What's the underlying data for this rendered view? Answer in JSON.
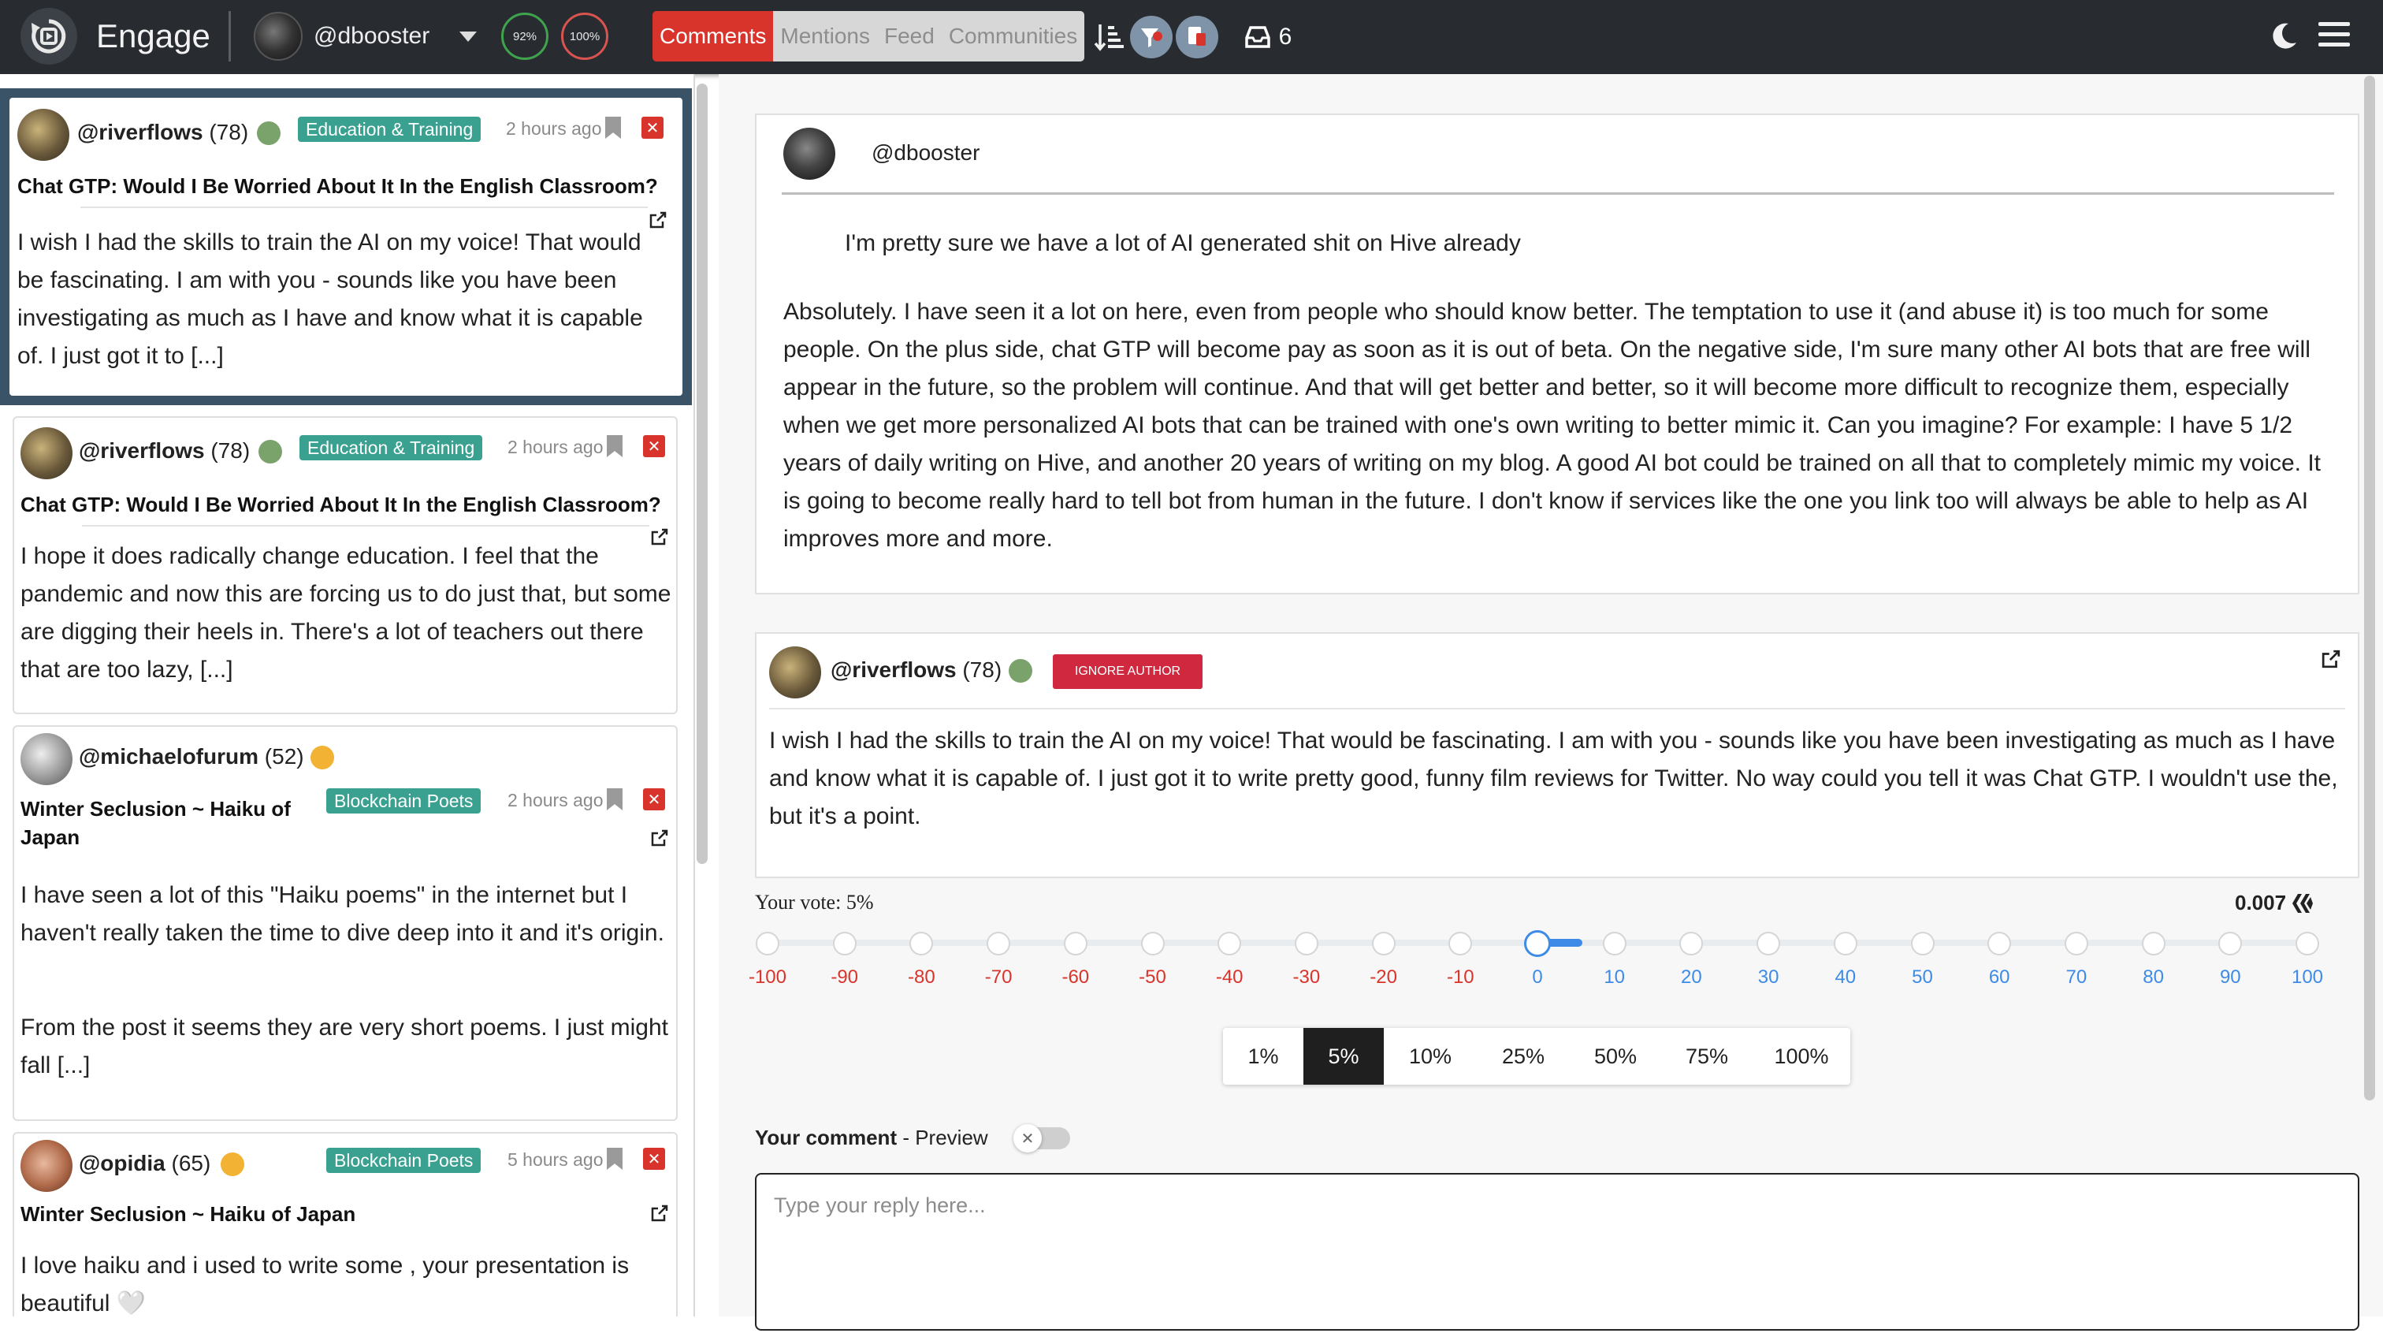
{
  "app": {
    "title": "Engage",
    "account": "@dbooster",
    "gauge_vp": "92%",
    "gauge_rc": "100%",
    "tabs": [
      {
        "label": "Comments",
        "active": true
      },
      {
        "label": "Mentions",
        "active": false
      },
      {
        "label": "Feed",
        "active": false
      },
      {
        "label": "Communities",
        "active": false
      }
    ],
    "inbox_count": "6",
    "colors": {
      "accent": "#d9342b",
      "topbar": "#282c31",
      "tag": "#3aa090",
      "vote_blue": "#3d8be6"
    }
  },
  "sidebar": {
    "cards": [
      {
        "author": "@riverflows",
        "rep": "(78)",
        "tag": "Education & Training",
        "time": "2 hours ago",
        "title": "Chat GTP: Would I Be Worried About It In the English Classroom?",
        "body": "I wish I had the skills to train the AI on my voice! That would be fascinating. I am with you - sounds like you have been investigating as much as I have and know what it is capable of. I just got it to [...]"
      },
      {
        "author": "@riverflows",
        "rep": "(78)",
        "tag": "Education & Training",
        "time": "2 hours ago",
        "title": "Chat GTP: Would I Be Worried About It In the English Classroom?",
        "body": "I hope it does radically change education. I feel that the pandemic and now this are forcing us to do just that, but some are digging their heels in. There's a lot of teachers out there that are too lazy, [...]"
      },
      {
        "author": "@michaelofurum",
        "rep": "(52)",
        "tag": "Blockchain Poets",
        "time": "2 hours ago",
        "title": "Winter Seclusion ~ Haiku of Japan",
        "body": "I have seen a lot of this \"Haiku poems\" in the internet but I haven't really taken the time to dive deep into it and it's origin.",
        "body2": "From the post it seems they are very short poems. I just might fall [...]"
      },
      {
        "author": "@opidia",
        "rep": "(65)",
        "tag": "Blockchain Poets",
        "time": "5 hours ago",
        "title": "Winter Seclusion ~ Haiku of Japan",
        "body": "I love haiku and i used to write some , your presentation is beautiful 🤍"
      }
    ]
  },
  "parent": {
    "author": "@dbooster",
    "quote": "I'm pretty sure we have a lot of AI generated shit on Hive already",
    "body": "Absolutely. I have seen it a lot on here, even from people who should know better. The temptation to use it (and abuse it) is too much for some people. On the plus side, chat GTP will become pay as soon as it is out of beta. On the negative side, I'm sure many other AI bots that are free will appear in the future, so the problem will continue. And that will get better and better, so it will become more difficult to recognize them, especially when we get more personalized AI bots that can be trained with one's own writing to better mimic it. Can you imagine? For example: I have 5 1/2 years of daily writing on Hive, and another 20 years of writing on my blog. A good AI bot could be trained on all that to completely mimic my voice. It is going to become really hard to tell bot from human in the future. I don't know if services like the one you link too will always be able to help as AI improves more and more."
  },
  "reply": {
    "author": "@riverflows",
    "rep": "(78)",
    "ignore_label": "IGNORE AUTHOR",
    "body": "I wish I had the skills to train the AI on my voice! That would be fascinating. I am with you - sounds like you have been investigating as much as I have and know what it is capable of. I just got it to write pretty good, funny film reviews for Twitter. No way could you tell it was Chat GTP. I wouldn't use the, but it's a point."
  },
  "vote": {
    "label": "Your vote: 5%",
    "value": "0.007",
    "percent": 5,
    "ticks": [
      "-100",
      "-90",
      "-80",
      "-70",
      "-60",
      "-50",
      "-40",
      "-30",
      "-20",
      "-10",
      "0",
      "10",
      "20",
      "30",
      "40",
      "50",
      "60",
      "70",
      "80",
      "90",
      "100"
    ],
    "presets": [
      {
        "label": "1%",
        "active": false
      },
      {
        "label": "5%",
        "active": true
      },
      {
        "label": "10%",
        "active": false
      },
      {
        "label": "25%",
        "active": false
      },
      {
        "label": "50%",
        "active": false
      },
      {
        "label": "75%",
        "active": false
      },
      {
        "label": "100%",
        "active": false
      }
    ]
  },
  "comment": {
    "label": "Your comment",
    "preview_label": " - Preview",
    "toggle_symbol": "✕",
    "placeholder": "Type your reply here..."
  }
}
